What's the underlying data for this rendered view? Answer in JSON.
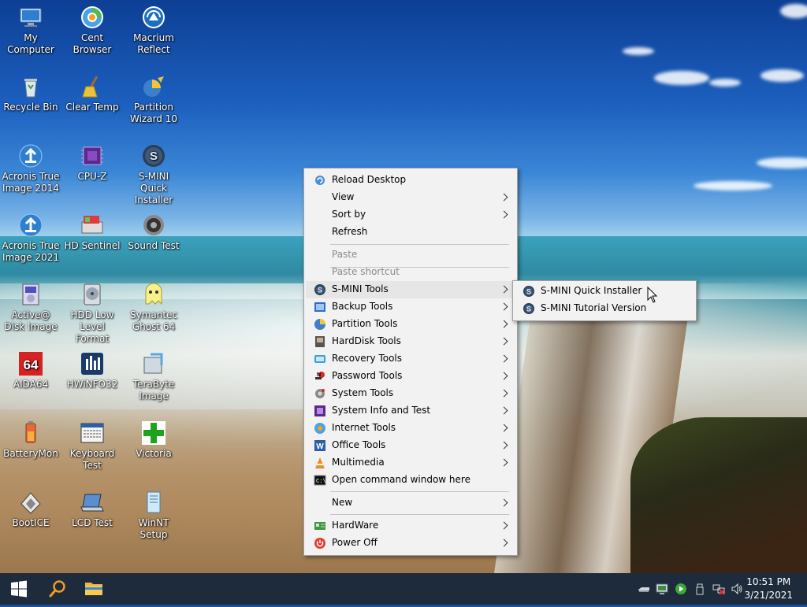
{
  "desktop": {
    "icons": [
      {
        "label": "My Computer",
        "icon": "computer-icon"
      },
      {
        "label": "Cent Browser",
        "icon": "browser-icon"
      },
      {
        "label": "Macrium Reflect",
        "icon": "macrium-icon"
      },
      {
        "label": "Recycle Bin",
        "icon": "recycle-bin-icon"
      },
      {
        "label": "Clear Temp",
        "icon": "broom-icon"
      },
      {
        "label": "Partition Wizard 10",
        "icon": "partition-wizard-icon"
      },
      {
        "label": "Acronis True Image 2014",
        "icon": "acronis-icon"
      },
      {
        "label": "CPU-Z",
        "icon": "cpu-icon"
      },
      {
        "label": "S-MINI Quick Installer",
        "icon": "s-mini-icon"
      },
      {
        "label": "Acronis True Image 2021",
        "icon": "acronis-icon"
      },
      {
        "label": "HD Sentinel",
        "icon": "hdd-sentinel-icon"
      },
      {
        "label": "Sound Test",
        "icon": "speaker-icon"
      },
      {
        "label": "Active@ Disk Image",
        "icon": "disk-image-icon"
      },
      {
        "label": "HDD Low Level Format",
        "icon": "hdd-icon"
      },
      {
        "label": "Symantec Ghost 64",
        "icon": "ghost-icon"
      },
      {
        "label": "AIDA64",
        "icon": "aida64-icon"
      },
      {
        "label": "HWiNFO32",
        "icon": "hwinfo-icon"
      },
      {
        "label": "TeraByte Image",
        "icon": "terabyte-icon"
      },
      {
        "label": "BatteryMon",
        "icon": "battery-icon"
      },
      {
        "label": "Keyboard Test",
        "icon": "keyboard-icon"
      },
      {
        "label": "Victoria",
        "icon": "cross-icon"
      },
      {
        "label": "BootICE",
        "icon": "bootice-icon"
      },
      {
        "label": "LCD Test",
        "icon": "laptop-icon"
      },
      {
        "label": "WinNT Setup",
        "icon": "setup-icon"
      }
    ]
  },
  "context_menu": {
    "items": [
      {
        "label": "Reload Desktop",
        "icon": "reload-icon",
        "submenu": false
      },
      {
        "label": "View",
        "submenu": true
      },
      {
        "label": "Sort by",
        "submenu": true
      },
      {
        "label": "Refresh",
        "submenu": false
      },
      {
        "label": "Paste",
        "disabled": true
      },
      {
        "label": "Paste shortcut",
        "disabled": true
      },
      {
        "label": "S-MINI Tools",
        "icon": "s-mini-icon",
        "submenu": true,
        "hover": true
      },
      {
        "label": "Backup Tools",
        "icon": "backup-icon",
        "submenu": true
      },
      {
        "label": "Partition Tools",
        "icon": "partition-icon",
        "submenu": true
      },
      {
        "label": "HardDisk Tools",
        "icon": "harddisk-icon",
        "submenu": true
      },
      {
        "label": "Recovery Tools",
        "icon": "recovery-icon",
        "submenu": true
      },
      {
        "label": "Password Tools",
        "icon": "password-icon",
        "submenu": true
      },
      {
        "label": "System Tools",
        "icon": "system-tools-icon",
        "submenu": true
      },
      {
        "label": "System Info and Test",
        "icon": "system-info-icon",
        "submenu": true
      },
      {
        "label": "Internet Tools",
        "icon": "internet-icon",
        "submenu": true
      },
      {
        "label": "Office Tools",
        "icon": "word-icon",
        "submenu": true
      },
      {
        "label": "Multimedia",
        "icon": "vlc-icon",
        "submenu": true
      },
      {
        "label": "Open command window here",
        "icon": "cmd-icon",
        "submenu": false
      },
      {
        "label": "New",
        "submenu": true
      },
      {
        "label": "HardWare",
        "icon": "hardware-icon",
        "submenu": true
      },
      {
        "label": "Power Off",
        "icon": "power-icon",
        "submenu": true
      }
    ]
  },
  "submenu": {
    "items": [
      {
        "label": "S-MINI Quick Installer",
        "icon": "s-mini-icon"
      },
      {
        "label": "S-MINI Tutorial Version",
        "icon": "s-mini-icon"
      }
    ]
  },
  "taskbar": {
    "start": "windows-start-icon",
    "search": "search-icon",
    "explorer": "folder-icon",
    "clock": {
      "time": "10:51 PM",
      "date": "3/21/2021"
    }
  }
}
